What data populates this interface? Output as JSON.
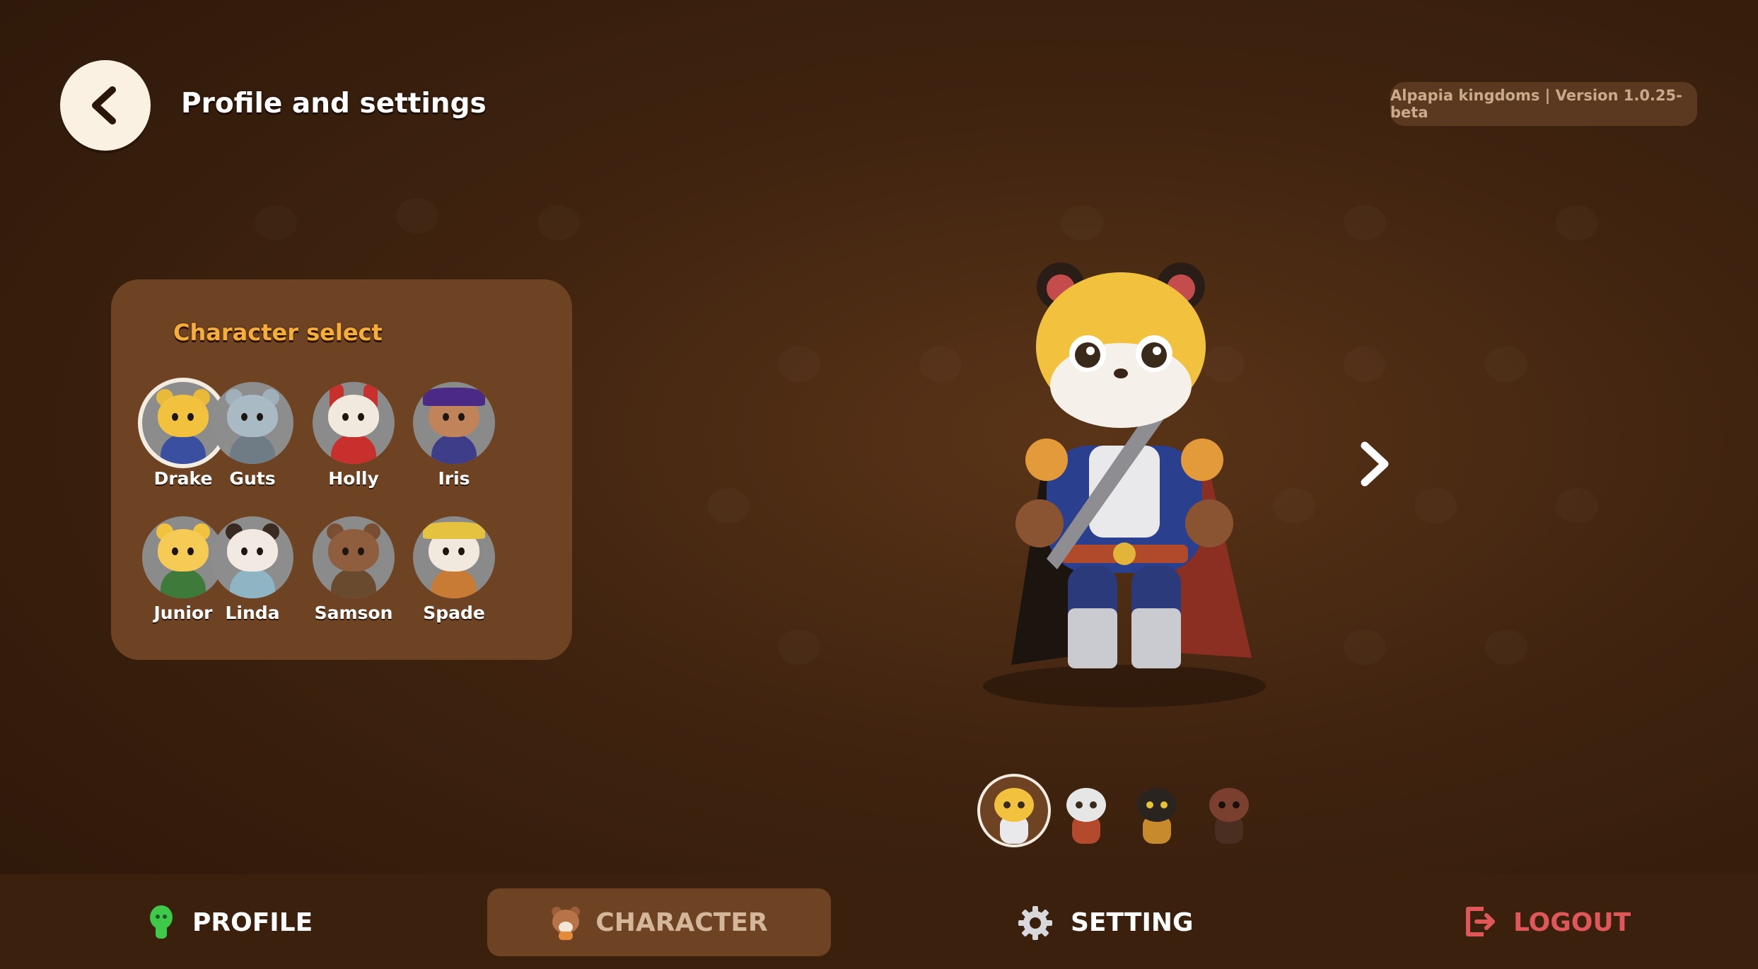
{
  "header": {
    "title": "Profile and settings",
    "version": "Alpapia kingdoms | Version 1.0.25-beta"
  },
  "character_panel": {
    "title": "Character select",
    "characters": [
      {
        "name": "Drake",
        "selected": true
      },
      {
        "name": "Guts"
      },
      {
        "name": "Holly"
      },
      {
        "name": "Iris"
      },
      {
        "name": "Junior"
      },
      {
        "name": "Linda"
      },
      {
        "name": "Samson"
      },
      {
        "name": "Spade"
      }
    ]
  },
  "variants": [
    "tiger-variant-icon",
    "raccoon-variant-icon",
    "black-cat-variant-icon",
    "bear-variant-icon"
  ],
  "nav": {
    "profile": "PROFILE",
    "character": "CHARACTER",
    "setting": "SETTING",
    "logout": "LOGOUT"
  },
  "colors": {
    "background": "#3f230f",
    "panel": "#6e4323",
    "accent_orange": "#f7ad3a",
    "logout_red": "#e0575a",
    "profile_green": "#3ec94a"
  }
}
